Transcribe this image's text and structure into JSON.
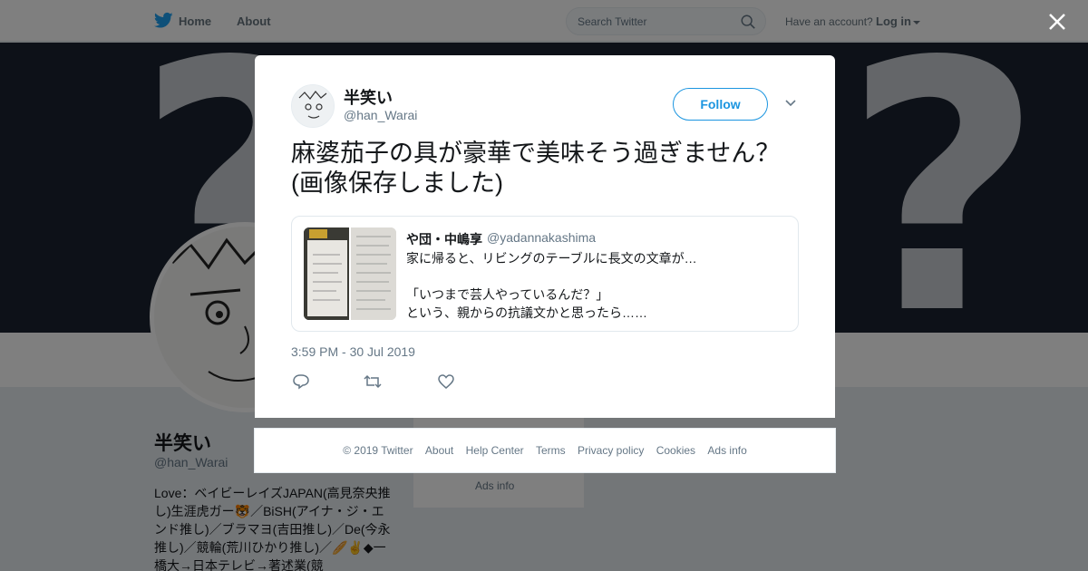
{
  "nav": {
    "home": "Home",
    "about": "About",
    "search_placeholder": "Search Twitter",
    "have_account": "Have an account?",
    "login": "Log in"
  },
  "profile": {
    "name": "半笑い",
    "handle": "@han_Warai",
    "bio": "Love：ベイビーレイズJAPAN(高見奈央推し)生涯虎ガー🐯／BiSH(アイナ・ジ・エンド推し)／ブラマヨ(吉田推し)／De(今永推し)／競輪(荒川ひかり推し)／🥖✌️◆一橋大→日本テレビ→著述業(競",
    "side_ads": "Ads info"
  },
  "tweet": {
    "author_name": "半笑い",
    "author_handle": "@han_Warai",
    "follow_label": "Follow",
    "text": "麻婆茄子の具が豪華で美味そう過ぎません？(画像保存しました)",
    "timestamp": "3:59 PM - 30 Jul 2019",
    "quote": {
      "name": "や団・中嶋享",
      "handle": "@yadannakashima",
      "line1": "家に帰ると、リビングのテーブルに長文の文章が…",
      "line2": "「いつまで芸人やっているんだ？」",
      "line3": "という、親からの抗議文かと思ったら……"
    }
  },
  "footer": {
    "copyright": "© 2019 Twitter",
    "about": "About",
    "help": "Help Center",
    "terms": "Terms",
    "privacy": "Privacy policy",
    "cookies": "Cookies",
    "ads": "Ads info"
  },
  "colors": {
    "twitter_blue": "#1b95e0",
    "text_primary": "#14171a",
    "text_secondary": "#657786"
  },
  "icons": [
    "twitter-bird-icon",
    "search-icon",
    "close-icon",
    "chevron-down-icon",
    "reply-icon",
    "retweet-icon",
    "like-icon"
  ]
}
